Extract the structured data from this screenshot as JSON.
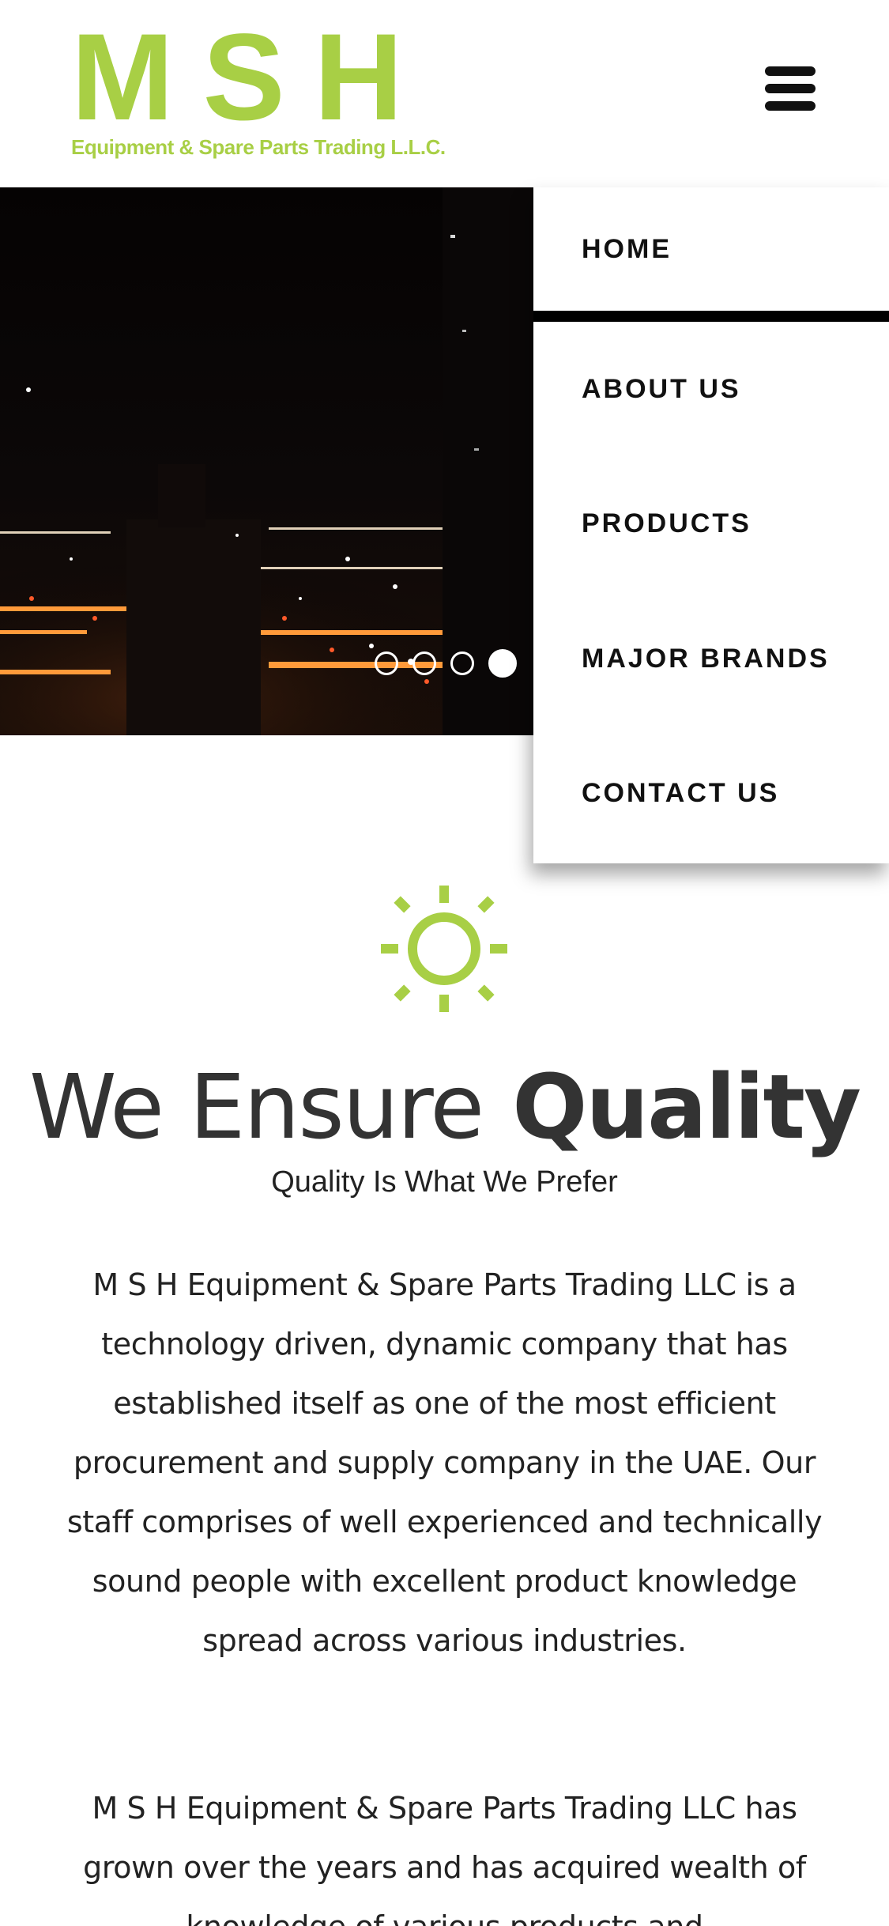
{
  "logo": {
    "mark_letters": [
      "M",
      "S",
      "H"
    ],
    "subtitle": "Equipment & Spare Parts Trading L.L.C."
  },
  "header": {
    "menu_icon": "hamburger-menu-icon"
  },
  "slider": {
    "slide_count": 4,
    "active_index": 3
  },
  "nav": {
    "items": [
      {
        "label": "HOME"
      },
      {
        "label": "ABOUT US"
      },
      {
        "label": "PRODUCTS"
      },
      {
        "label": "MAJOR BRANDS"
      },
      {
        "label": "CONTACT US"
      }
    ],
    "active_index": 0
  },
  "main": {
    "icon": "sun-icon",
    "title_light": "We Ensure",
    "title_bold": "Quality",
    "subtitle": "Quality Is What We Prefer",
    "paragraph1": "M S H Equipment & Spare Parts Trading LLC is a technology driven, dynamic company that has established itself as one of the most efficient procurement and supply company in the UAE. Our staff comprises of well experienced and technically sound people with excellent product knowledge spread across various industries.",
    "paragraph2": "M S H Equipment & Spare Parts Trading LLC has grown over the years and has acquired wealth of knowledge of various products and"
  },
  "colors": {
    "brand_green": "#a8cf45",
    "text_dark": "#333333",
    "hero_bg": "#060404"
  }
}
